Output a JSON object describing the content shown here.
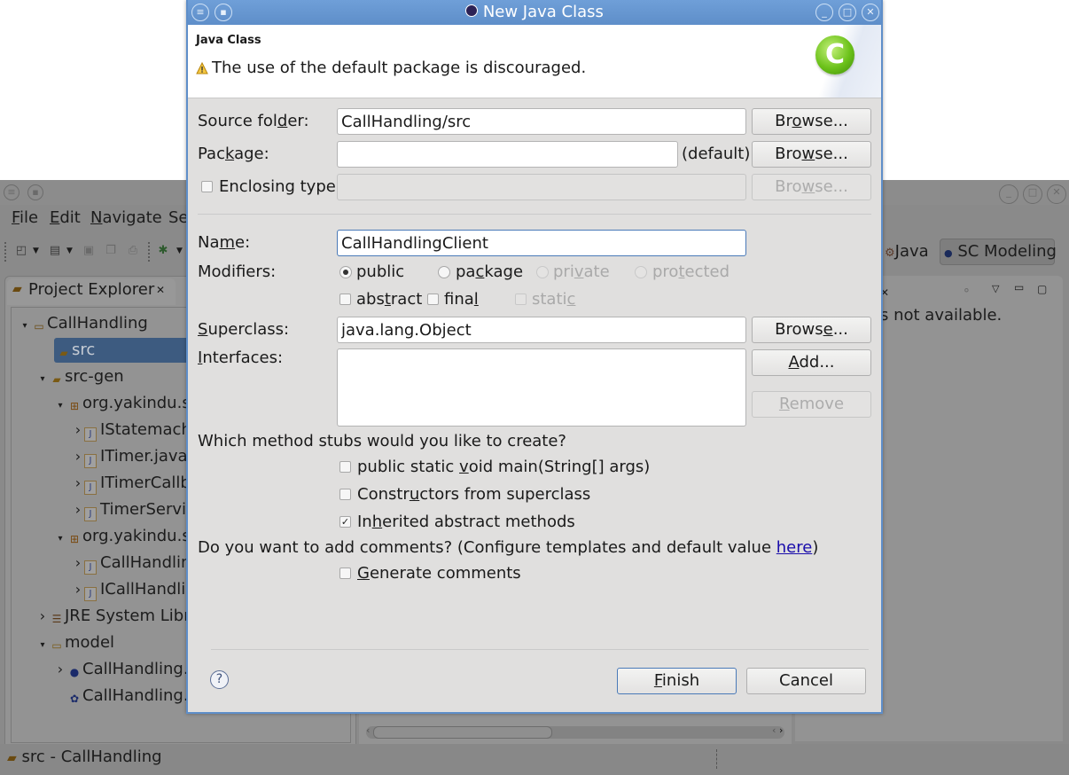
{
  "ide": {
    "menu": [
      "File",
      "Edit",
      "Navigate",
      "Se"
    ],
    "menu_mnemonics": [
      "F",
      "E",
      "N",
      ""
    ],
    "perspectives": {
      "java": "Java",
      "sc_modeling": "SC Modeling"
    },
    "project_explorer": {
      "tab_label": "Project Explorer",
      "tree": [
        {
          "label": "CallHandling",
          "level": 0,
          "expander": "down",
          "icon": "project-icon"
        },
        {
          "label": "src",
          "level": 1,
          "expander": "",
          "icon": "source-folder-icon",
          "selected": true
        },
        {
          "label": "src-gen",
          "level": 1,
          "expander": "down",
          "icon": "source-folder-icon"
        },
        {
          "label": "org.yakindu.sc",
          "level": 2,
          "expander": "down",
          "icon": "package-icon"
        },
        {
          "label": "IStatemachi",
          "level": 3,
          "expander": "right",
          "icon": "java-file-icon"
        },
        {
          "label": "ITimer.java",
          "level": 3,
          "expander": "right",
          "icon": "java-file-icon"
        },
        {
          "label": "ITimerCallba",
          "level": 3,
          "expander": "right",
          "icon": "java-file-icon"
        },
        {
          "label": "TimerServic",
          "level": 3,
          "expander": "right",
          "icon": "java-file-icon"
        },
        {
          "label": "org.yakindu.sc",
          "level": 2,
          "expander": "down",
          "icon": "package-icon"
        },
        {
          "label": "CallHandlin",
          "level": 3,
          "expander": "right",
          "icon": "java-file-icon"
        },
        {
          "label": "ICallHandlin",
          "level": 3,
          "expander": "right",
          "icon": "java-file-icon"
        },
        {
          "label": "JRE System Libra",
          "level": 1,
          "expander": "right",
          "icon": "library-icon"
        },
        {
          "label": "model",
          "level": 1,
          "expander": "down",
          "icon": "folder-icon"
        },
        {
          "label": "CallHandling.s",
          "level": 2,
          "expander": "right",
          "icon": "statechart-icon"
        },
        {
          "label": "CallHandling.s",
          "level": 2,
          "expander": "",
          "icon": "sgen-icon"
        }
      ]
    },
    "right_view_message": "s not available.",
    "status_text": "src - CallHandling"
  },
  "dialog": {
    "title": "New Java Class",
    "header_title": "Java Class",
    "header_message": "The use of the default package is discouraged.",
    "logo_letter": "C",
    "source_folder": {
      "label": "Source folder:",
      "value": "CallHandling/src",
      "browse": "Browse..."
    },
    "package": {
      "label": "Package:",
      "value": "",
      "default_hint": "(default)",
      "browse": "Browse..."
    },
    "enclosing_type": {
      "label": "Enclosing type:",
      "checked": false,
      "value": "",
      "browse": "Browse..."
    },
    "name": {
      "label": "Name:",
      "value": "CallHandlingClient"
    },
    "modifiers": {
      "label": "Modifiers:",
      "access": [
        {
          "label": "public",
          "selected": true,
          "enabled": true
        },
        {
          "label": "package",
          "selected": false,
          "enabled": true
        },
        {
          "label": "private",
          "selected": false,
          "enabled": false
        },
        {
          "label": "protected",
          "selected": false,
          "enabled": false
        }
      ],
      "flags": [
        {
          "label": "abstract",
          "checked": false,
          "enabled": true
        },
        {
          "label": "final",
          "checked": false,
          "enabled": true
        },
        {
          "label": "static",
          "checked": false,
          "enabled": false
        }
      ]
    },
    "superclass": {
      "label": "Superclass:",
      "value": "java.lang.Object",
      "browse": "Browse..."
    },
    "interfaces": {
      "label": "Interfaces:",
      "items": [],
      "add": "Add...",
      "remove": "Remove"
    },
    "stubs": {
      "question": "Which method stubs would you like to create?",
      "options": [
        {
          "label": "public static void main(String[] args)",
          "checked": false
        },
        {
          "label": "Constructors from superclass",
          "checked": false
        },
        {
          "label": "Inherited abstract methods",
          "checked": true
        }
      ]
    },
    "comments": {
      "question_prefix": "Do you want to add comments? (Configure templates and default value ",
      "link": "here",
      "question_suffix": ")",
      "option": {
        "label": "Generate comments",
        "checked": false
      }
    },
    "buttons": {
      "finish": "Finish",
      "cancel": "Cancel"
    }
  },
  "colors": {
    "dialog_border": "#5e8ec9",
    "link": "#1a0dab",
    "selection": "#3d5b80"
  }
}
